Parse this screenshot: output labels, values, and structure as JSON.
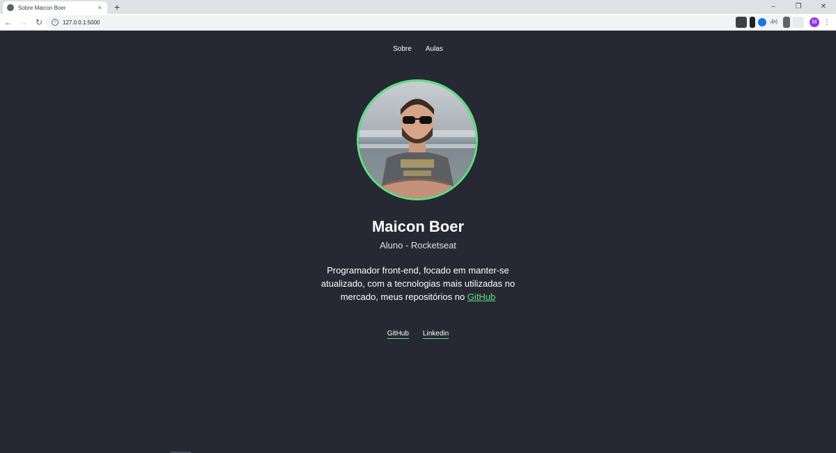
{
  "browser": {
    "tab": {
      "title": "Sobre Maicon Boer",
      "favicon": "globe-icon",
      "close": "×"
    },
    "new_tab": "+",
    "window_controls": {
      "minimize": "–",
      "restore": "❐",
      "close": "✕"
    },
    "nav": {
      "back": "←",
      "forward": "→",
      "reload": "↻"
    },
    "url": "127.0.0.1:5000",
    "url_icon": "i",
    "omnibox_icons": {
      "zoom": "⌕",
      "bookmark": "☆"
    },
    "extensions": [
      {
        "name": "ext-1",
        "label": "",
        "color": "#3c4043"
      },
      {
        "name": "ext-2",
        "label": "",
        "color": "#202124"
      },
      {
        "name": "ext-3",
        "label": "",
        "color": "#1a73e8"
      },
      {
        "name": "ext-4",
        "label": "{x}",
        "color": "#ffffff"
      },
      {
        "name": "ext-5",
        "label": "",
        "color": "#5f6368"
      },
      {
        "name": "ext-6",
        "label": "",
        "color": "#e8eaed"
      }
    ],
    "profile_initial": "M",
    "menu": "⋮"
  },
  "site": {
    "nav": {
      "about": "Sobre",
      "classes": "Aulas"
    },
    "name": "Maicon Boer",
    "role": "Aluno - Rocketseat",
    "bio_text": "Programador front-end, focado em manter-se atualizado, com a tecnologias mais utilizadas no mercado, meus repositórios no ",
    "bio_link": "GitHub",
    "footer": {
      "github": "GitHub",
      "linkedin": "Linkedin"
    },
    "accent_color": "#5ee27e",
    "background_color": "#262833"
  }
}
